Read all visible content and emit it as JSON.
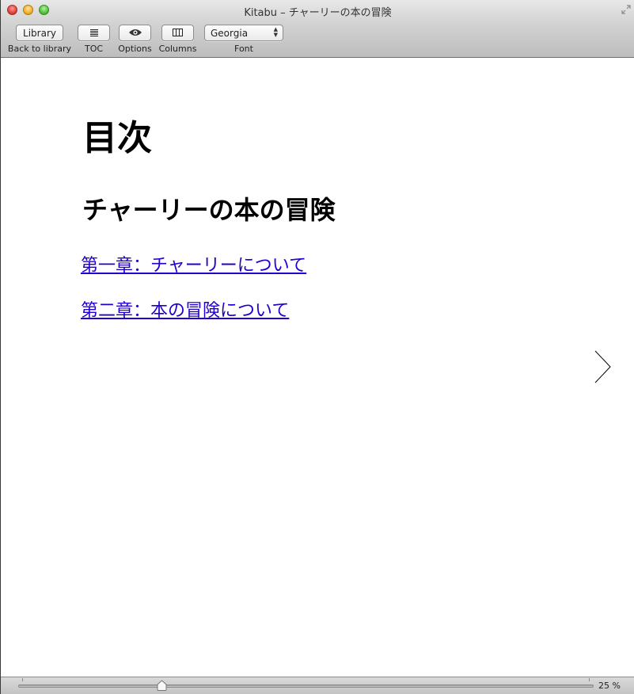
{
  "window": {
    "title": "Kitabu – チャーリーの本の冒険"
  },
  "toolbar": {
    "library_button": "Library",
    "library_label": "Back to library",
    "toc_label": "TOC",
    "options_label": "Options",
    "columns_label": "Columns",
    "font_value": "Georgia",
    "font_label": "Font"
  },
  "icons": {
    "toc": "list-icon",
    "options": "eye-icon",
    "columns": "columns-icon",
    "next": "chevron-right-icon",
    "fullscreen": "fullscreen-icon"
  },
  "book": {
    "heading": "目次",
    "title": "チャーリーの本の冒険",
    "chapters": [
      {
        "label": "第一章：チャーリーについて"
      },
      {
        "label": "第二章：本の冒険について"
      }
    ],
    "link_color": "#2200cc"
  },
  "progress": {
    "value_percent": 25,
    "label": "25 %"
  }
}
